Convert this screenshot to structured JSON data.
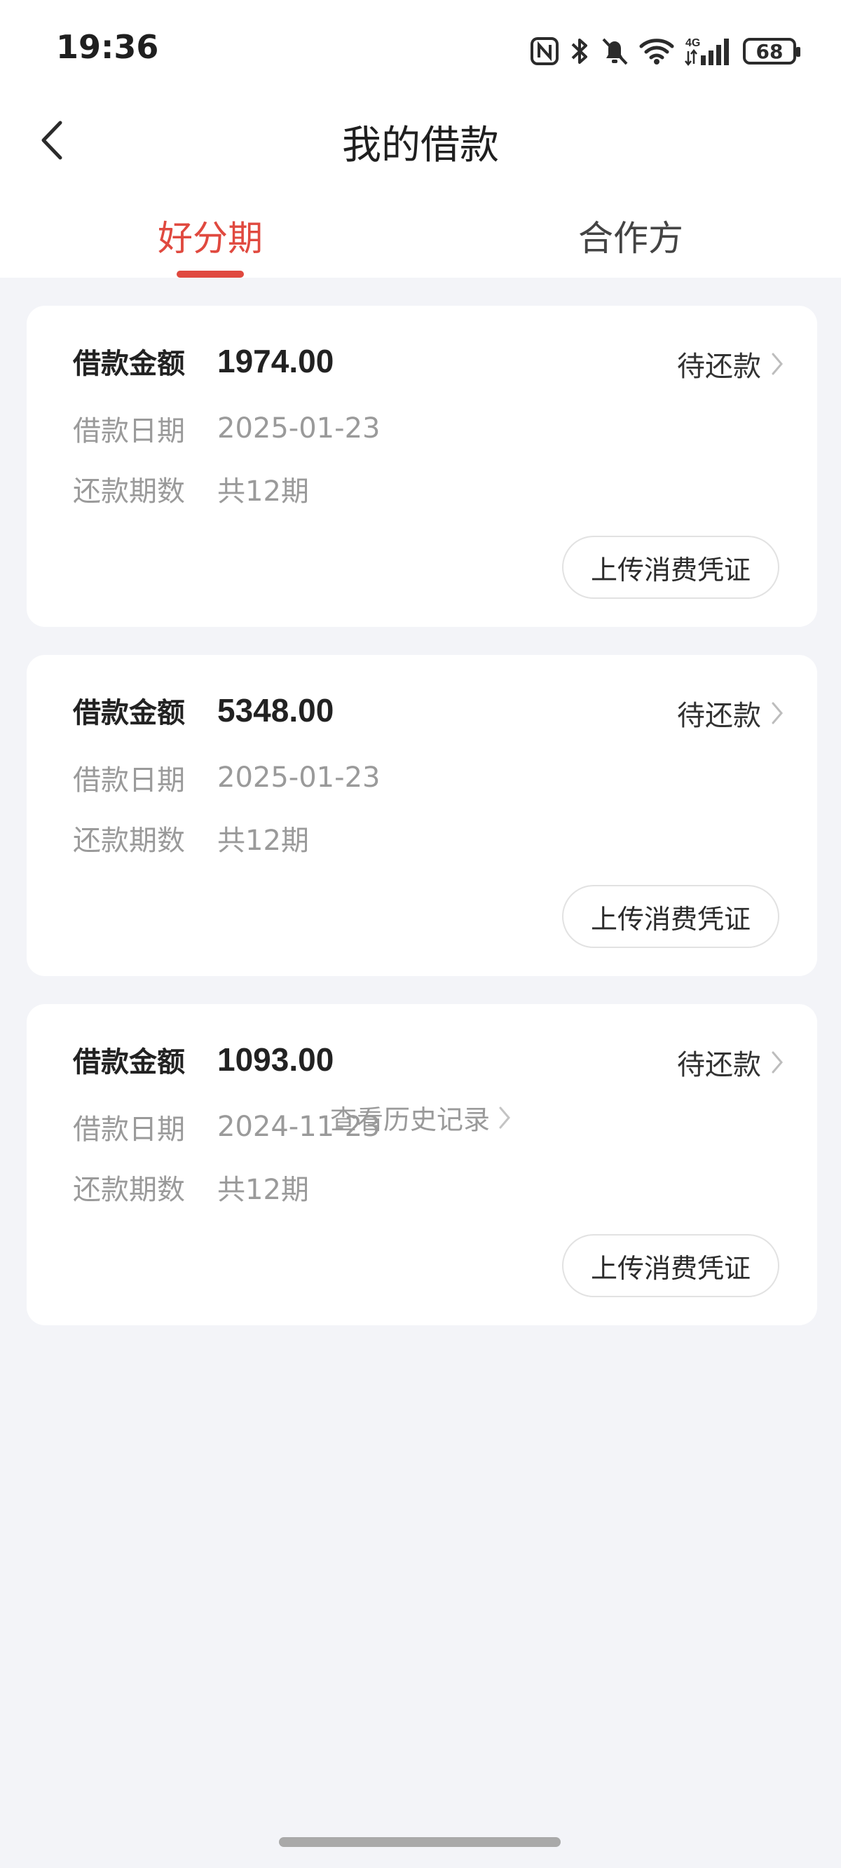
{
  "status_bar": {
    "time": "19:36",
    "network": "4G",
    "battery": "68",
    "icons": [
      "nfc-icon",
      "bluetooth-icon",
      "bell-muted-icon",
      "wifi-icon",
      "signal-icon",
      "battery-icon"
    ]
  },
  "header": {
    "title": "我的借款",
    "back_icon": "chevron-left-icon"
  },
  "tabs": [
    {
      "label": "好分期",
      "active": true
    },
    {
      "label": "合作方",
      "active": false
    }
  ],
  "loans": [
    {
      "amount_label": "借款金额",
      "amount": "1974.00",
      "date_label": "借款日期",
      "date": "2025-01-23",
      "periods_label": "还款期数",
      "periods": "共12期",
      "status": "待还款",
      "button": "上传消费凭证"
    },
    {
      "amount_label": "借款金额",
      "amount": "5348.00",
      "date_label": "借款日期",
      "date": "2025-01-23",
      "periods_label": "还款期数",
      "periods": "共12期",
      "status": "待还款",
      "button": "上传消费凭证"
    },
    {
      "amount_label": "借款金额",
      "amount": "1093.00",
      "date_label": "借款日期",
      "date": "2024-11-23",
      "periods_label": "还款期数",
      "periods": "共12期",
      "status": "待还款",
      "button": "上传消费凭证"
    }
  ],
  "history_link": "查看历史记录",
  "colors": {
    "accent": "#e0493f",
    "background": "#f3f4f8",
    "card": "#ffffff",
    "muted_text": "#9a9a9a"
  }
}
